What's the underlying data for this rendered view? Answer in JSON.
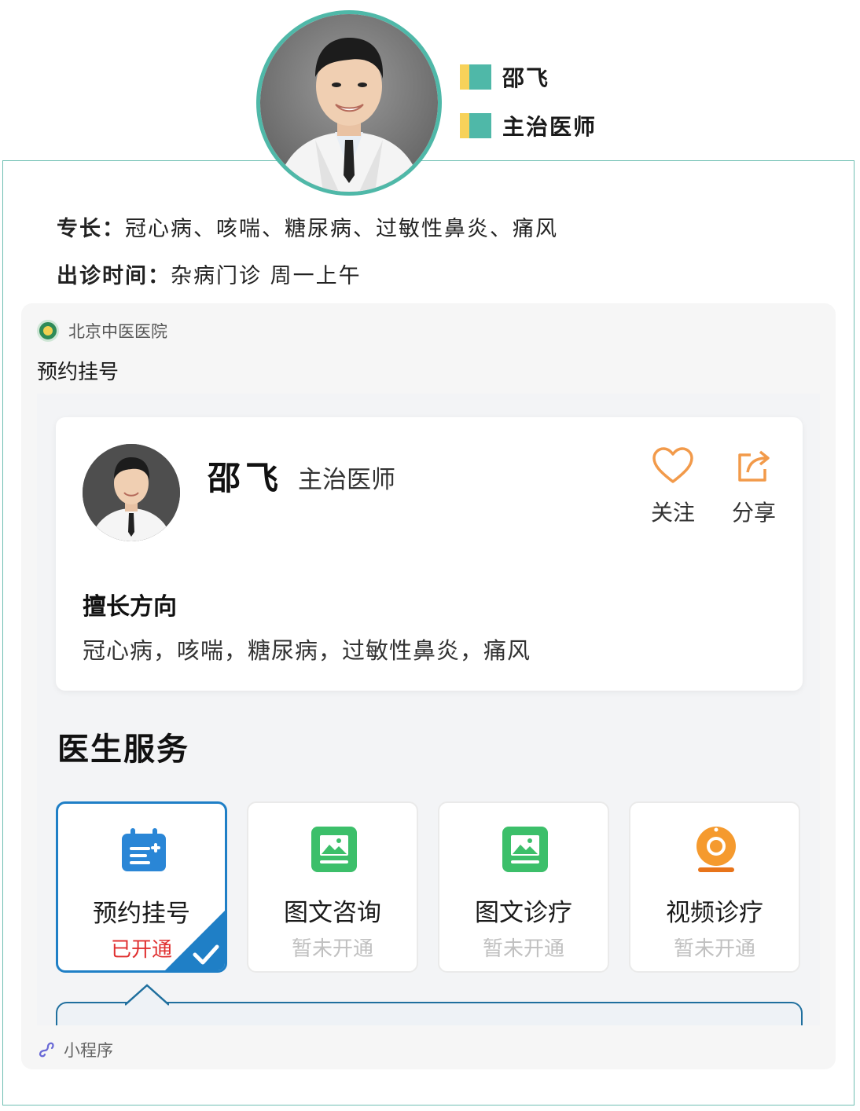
{
  "header": {
    "name": "邵飞",
    "title": "主治医师"
  },
  "info": {
    "specialty_label": "专长：",
    "specialty_value": "冠心病、咳喘、糖尿病、过敏性鼻炎、痛风",
    "visit_label": "出诊时间：",
    "visit_value": "杂病门诊 周一上午"
  },
  "miniprogram": {
    "source_name": "北京中医医院",
    "title": "预约挂号",
    "footer_label": "小程序",
    "doctor_card": {
      "name": "邵飞",
      "rank": "主治医师",
      "follow_label": "关注",
      "share_label": "分享",
      "good_title": "擅长方向",
      "good_text": "冠心病，咳喘，糖尿病，过敏性鼻炎，痛风"
    },
    "services_title": "医生服务",
    "services": [
      {
        "name": "预约挂号",
        "status": "已开通",
        "icon": "calendar-icon",
        "active": true
      },
      {
        "name": "图文咨询",
        "status": "暂未开通",
        "icon": "image-icon",
        "active": false
      },
      {
        "name": "图文诊疗",
        "status": "暂未开通",
        "icon": "image-icon",
        "active": false
      },
      {
        "name": "视频诊疗",
        "status": "暂未开通",
        "icon": "webcam-icon",
        "active": false
      }
    ]
  },
  "colors": {
    "accent_teal": "#4fb8a8",
    "accent_yellow": "#f7d25a",
    "active_blue": "#1f7fc6",
    "open_red": "#e03030",
    "follow_orange": "#f29a4a"
  }
}
